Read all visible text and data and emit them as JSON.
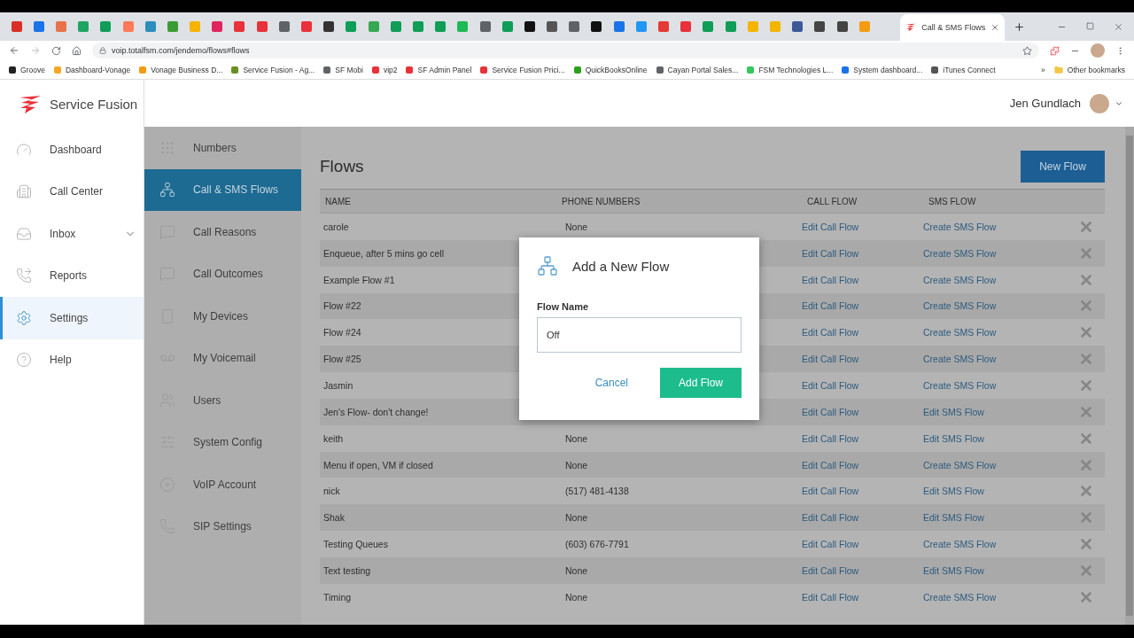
{
  "browser": {
    "pinned_tabs": [
      {
        "color": "#d93025"
      },
      {
        "color": "#1a73e8"
      },
      {
        "color": "#e8734a"
      },
      {
        "color": "#1fa463"
      },
      {
        "color": "#0f9d58"
      },
      {
        "color": "#ff7a59"
      },
      {
        "color": "#2c8ebb"
      },
      {
        "color": "#3d9b35"
      },
      {
        "color": "#f4b400"
      },
      {
        "color": "#e0245e"
      },
      {
        "color": "#e8313a"
      },
      {
        "color": "#e8313a"
      },
      {
        "color": "#5f6368"
      },
      {
        "color": "#e8313a"
      },
      {
        "color": "#333333"
      },
      {
        "color": "#0f9d58"
      },
      {
        "color": "#34a853"
      },
      {
        "color": "#0f9d58"
      },
      {
        "color": "#0f9d58"
      },
      {
        "color": "#0f9d58"
      },
      {
        "color": "#1db954"
      },
      {
        "color": "#5f6368"
      },
      {
        "color": "#0f9d58"
      },
      {
        "color": "#111111"
      },
      {
        "color": "#555555"
      },
      {
        "color": "#5f6368"
      },
      {
        "color": "#111111"
      },
      {
        "color": "#1a73e8"
      },
      {
        "color": "#2196f3"
      },
      {
        "color": "#e53935"
      },
      {
        "color": "#e8313a"
      },
      {
        "color": "#0f9d58"
      },
      {
        "color": "#0f9d58"
      },
      {
        "color": "#f4b400"
      },
      {
        "color": "#f4b400"
      },
      {
        "color": "#3b5998"
      },
      {
        "color": "#444444"
      },
      {
        "color": "#444444"
      },
      {
        "color": "#f39c12"
      }
    ],
    "active_tab": {
      "title": "Call & SMS Flows"
    },
    "address": "voip.totalfsm.com/jendemo/flows#flows",
    "bookmarks": [
      {
        "label": "Groove",
        "color": "#222222"
      },
      {
        "label": "Dashboard-Vonage",
        "color": "#f5a623"
      },
      {
        "label": "Vonage Business D...",
        "color": "#f39c12"
      },
      {
        "label": "Service Fusion - Ag...",
        "color": "#6b8e23"
      },
      {
        "label": "SF Mobi",
        "color": "#5f6368"
      },
      {
        "label": "vip2",
        "color": "#e8313a"
      },
      {
        "label": "SF Admin Panel",
        "color": "#e8313a"
      },
      {
        "label": "Service Fusion Prici...",
        "color": "#e8313a"
      },
      {
        "label": "QuickBooksOnline",
        "color": "#2ca01c"
      },
      {
        "label": "Cayan Portal Sales...",
        "color": "#5f6368"
      },
      {
        "label": "FSM Technologies L...",
        "color": "#34c759"
      },
      {
        "label": "System dashboard...",
        "color": "#1a73e8"
      },
      {
        "label": "iTunes Connect",
        "color": "#555555"
      }
    ],
    "more_bookmarks": "»",
    "other_bookmarks": "Other bookmarks"
  },
  "app": {
    "logo": "Service Fusion",
    "user": "Jen Gundlach",
    "nav": [
      {
        "label": "Dashboard",
        "selected": false,
        "expandable": false
      },
      {
        "label": "Call Center",
        "selected": false,
        "expandable": false
      },
      {
        "label": "Inbox",
        "selected": false,
        "expandable": true
      },
      {
        "label": "Reports",
        "selected": false,
        "expandable": false
      },
      {
        "label": "Settings",
        "selected": true,
        "expandable": false
      },
      {
        "label": "Help",
        "selected": false,
        "expandable": false
      }
    ],
    "subnav": [
      {
        "label": "Numbers",
        "selected": false
      },
      {
        "label": "Call & SMS Flows",
        "selected": true
      },
      {
        "label": "Call Reasons",
        "selected": false
      },
      {
        "label": "Call Outcomes",
        "selected": false
      },
      {
        "label": "My Devices",
        "selected": false
      },
      {
        "label": "My Voicemail",
        "selected": false
      },
      {
        "label": "Users",
        "selected": false
      },
      {
        "label": "System Config",
        "selected": false
      },
      {
        "label": "VoIP Account",
        "selected": false
      },
      {
        "label": "SIP Settings",
        "selected": false
      }
    ],
    "page_title": "Flows",
    "new_button": "New Flow",
    "table": {
      "columns": [
        "NAME",
        "PHONE NUMBERS",
        "CALL FLOW",
        "SMS FLOW"
      ],
      "rows": [
        {
          "name": "carole",
          "phone": "None",
          "call_flow": "Edit Call Flow",
          "sms_flow": "Create SMS Flow"
        },
        {
          "name": "Enqueue, after 5 mins go cell",
          "call_flow": "Edit Call Flow",
          "sms_flow": "Create SMS Flow"
        },
        {
          "name": "Example Flow #1",
          "call_flow": "Edit Call Flow",
          "sms_flow": "Create SMS Flow"
        },
        {
          "name": "Flow #22",
          "call_flow": "Edit Call Flow",
          "sms_flow": "Create SMS Flow"
        },
        {
          "name": "Flow #24",
          "call_flow": "Edit Call Flow",
          "sms_flow": "Create SMS Flow"
        },
        {
          "name": "Flow #25",
          "call_flow": "Edit Call Flow",
          "sms_flow": "Create SMS Flow"
        },
        {
          "name": "Jasmin",
          "call_flow": "Edit Call Flow",
          "sms_flow": "Create SMS Flow"
        },
        {
          "name": "Jen's Flow- don't change!",
          "call_flow": "Edit Call Flow",
          "sms_flow": "Edit SMS Flow"
        },
        {
          "name": "keith",
          "phone": "None",
          "call_flow": "Edit Call Flow",
          "sms_flow": "Edit SMS Flow"
        },
        {
          "name": "Menu if open, VM if closed",
          "phone": "None",
          "call_flow": "Edit Call Flow",
          "sms_flow": "Create SMS Flow"
        },
        {
          "name": "nick",
          "phone": "(517) 481-4138",
          "call_flow": "Edit Call Flow",
          "sms_flow": "Edit SMS Flow"
        },
        {
          "name": "Shak",
          "phone": "None",
          "call_flow": "Edit Call Flow",
          "sms_flow": "Edit SMS Flow"
        },
        {
          "name": "Testing Queues",
          "phone": "(603) 676-7791",
          "call_flow": "Edit Call Flow",
          "sms_flow": "Create SMS Flow"
        },
        {
          "name": "Text testing",
          "phone": "None",
          "call_flow": "Edit Call Flow",
          "sms_flow": "Edit SMS Flow"
        },
        {
          "name": "Timing",
          "phone": "None",
          "call_flow": "Edit Call Flow",
          "sms_flow": "Create SMS Flow"
        }
      ]
    },
    "dialog": {
      "title": "Add a New Flow",
      "field_label": "Flow Name",
      "value": "Off",
      "cancel": "Cancel",
      "submit": "Add Flow"
    }
  }
}
